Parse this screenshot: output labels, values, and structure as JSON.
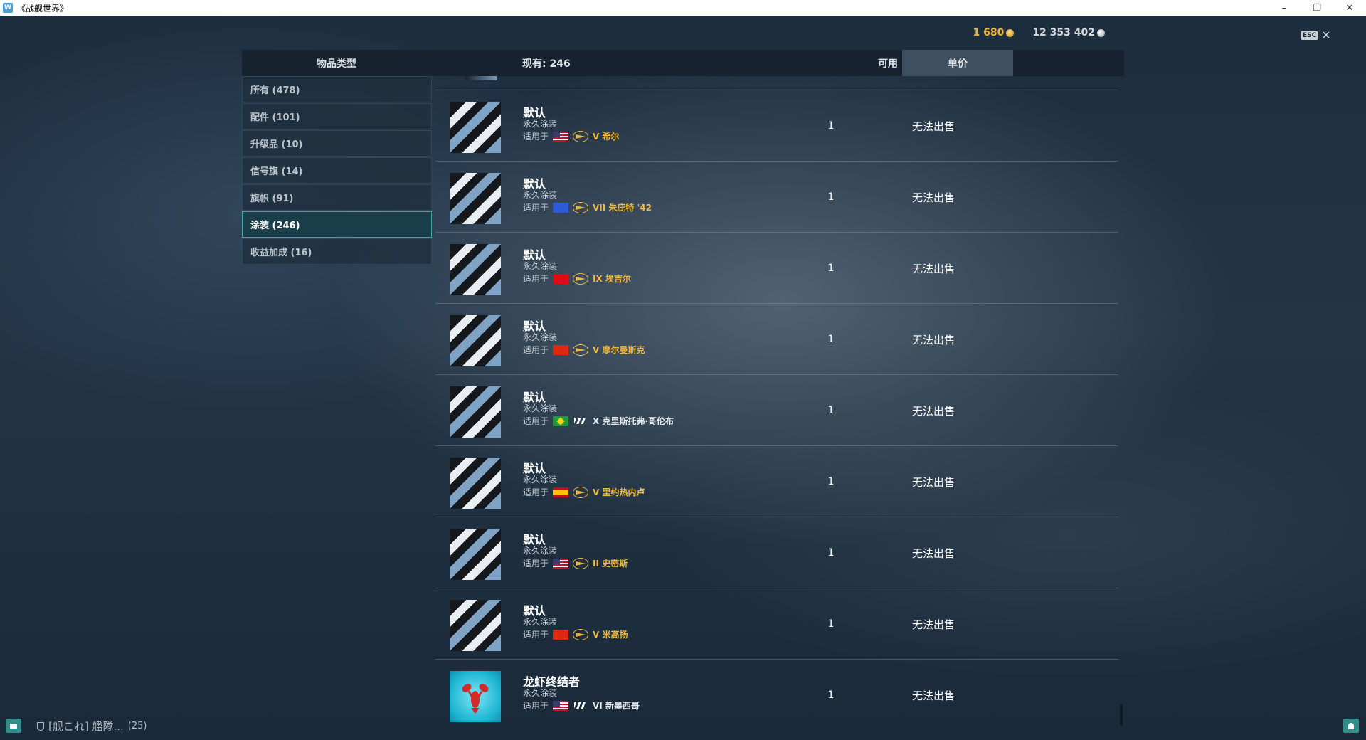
{
  "window": {
    "title": "《战舰世界》"
  },
  "currency": {
    "doubloons": "1 680",
    "credits": "12 353 402"
  },
  "esc_label": "ESC",
  "header": {
    "type_label": "物品类型",
    "count_label": "现有:  246",
    "available_label": "可用",
    "price_label": "单价"
  },
  "sidebar": {
    "items": [
      {
        "label": "所有 (478)"
      },
      {
        "label": "配件 (101)"
      },
      {
        "label": "升级品 (10)"
      },
      {
        "label": "信号旗 (14)"
      },
      {
        "label": "旗帜 (91)"
      },
      {
        "label": "涂装 (246)",
        "active": true
      },
      {
        "label": "收益加成 (16)"
      }
    ]
  },
  "common": {
    "applies_label": "适用于"
  },
  "rows": [
    {
      "name": "默认",
      "kind": "永久涂装",
      "flag": "us",
      "class_icon": "elite",
      "ship": "V 希尔",
      "ship_color": "gold",
      "available": "1",
      "price": "无法出售"
    },
    {
      "name": "默认",
      "kind": "永久涂装",
      "flag": "eu",
      "class_icon": "elite",
      "ship": "VII 朱庇特 '42",
      "ship_color": "gold",
      "available": "1",
      "price": "无法出售"
    },
    {
      "name": "默认",
      "kind": "永久涂装",
      "flag": "tr",
      "class_icon": "elite",
      "ship": "IX 埃吉尔",
      "ship_color": "gold",
      "available": "1",
      "price": "无法出售"
    },
    {
      "name": "默认",
      "kind": "永久涂装",
      "flag": "cn",
      "class_icon": "elite",
      "ship": "V 摩尔曼斯克",
      "ship_color": "gold",
      "available": "1",
      "price": "无法出售"
    },
    {
      "name": "默认",
      "kind": "永久涂装",
      "flag": "br",
      "class_icon": "plain",
      "ship": "X 克里斯托弗·哥伦布",
      "ship_color": "white",
      "available": "1",
      "price": "无法出售"
    },
    {
      "name": "默认",
      "kind": "永久涂装",
      "flag": "es",
      "class_icon": "elite",
      "ship": "V 里约热内卢",
      "ship_color": "gold",
      "available": "1",
      "price": "无法出售"
    },
    {
      "name": "默认",
      "kind": "永久涂装",
      "flag": "us",
      "class_icon": "elite",
      "ship": "II 史密斯",
      "ship_color": "gold",
      "available": "1",
      "price": "无法出售"
    },
    {
      "name": "默认",
      "kind": "永久涂装",
      "flag": "cn",
      "class_icon": "elite",
      "ship": "V 米高扬",
      "ship_color": "gold",
      "available": "1",
      "price": "无法出售"
    },
    {
      "name": "龙虾终结者",
      "kind": "永久涂装",
      "flag": "us",
      "class_icon": "plain",
      "ship": "VI 新墨西哥",
      "ship_color": "white",
      "available": "1",
      "price": "无法出售",
      "thumb": "lobster"
    }
  ],
  "bottom": {
    "clan_text": "[舰これ] 艦隊...",
    "clan_count": "(25)"
  }
}
